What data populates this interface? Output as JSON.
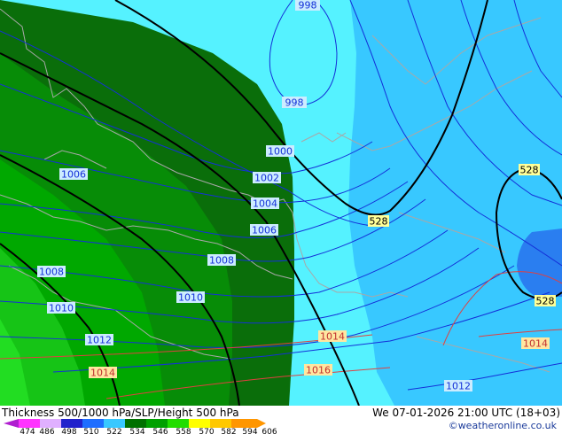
{
  "map": {
    "title": "Thickness 500/1000 hPa/SLP/Height 500 hPa",
    "valid_time": "We 07-01-2026 21:00 UTC (18+03)",
    "credit": "©weatheronline.co.uk",
    "slp_isobar_labels": [
      "998",
      "998",
      "1000",
      "1002",
      "1004",
      "1006",
      "1006",
      "1008",
      "1008",
      "1010",
      "1010",
      "1012",
      "1014",
      "1014",
      "1016",
      "1014",
      "1012"
    ],
    "height500_labels": [
      "528",
      "528",
      "528"
    ],
    "colorbar": {
      "ticks": [
        "474",
        "486",
        "498",
        "510",
        "522",
        "534",
        "546",
        "558",
        "570",
        "582",
        "594",
        "606"
      ],
      "colors": [
        "#b01fd0",
        "#ff33ff",
        "#e0b0ff",
        "#2222cc",
        "#1e6eff",
        "#38c8ff",
        "#007000",
        "#00a000",
        "#22dd00",
        "#ffff00",
        "#ffc800",
        "#ff9600"
      ]
    },
    "colors": {
      "thickness_522_534": "#38c8ff",
      "thickness_534_546": "#55f2ff",
      "thickness_546_558": "#007000",
      "isobar_line": "#1430d8",
      "isobar_label_bg": "#ccecff",
      "height_line": "#000000",
      "height_label_bg": "#ffff99"
    }
  }
}
